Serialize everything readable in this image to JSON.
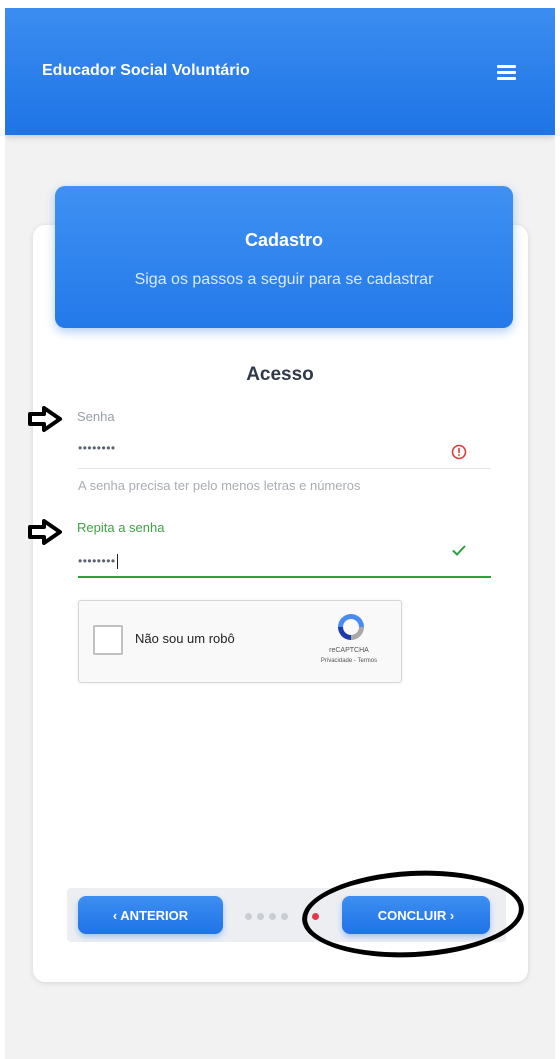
{
  "app": {
    "title": "Educador Social Voluntário",
    "menu_icon": "hamburger-menu-icon"
  },
  "card": {
    "title": "Cadastro",
    "subtitle": "Siga os passos a seguir para se cadastrar"
  },
  "section": {
    "title": "Acesso"
  },
  "password": {
    "label": "Senha",
    "value": "••••••••",
    "helper": "A senha precisa ter pelo menos letras e números",
    "status_icon": "error-icon",
    "status_color": "#e53935"
  },
  "confirm_password": {
    "label": "Repita a senha",
    "value": "••••••••",
    "status_icon": "check-icon",
    "status_color": "#2e9e3e"
  },
  "recaptcha": {
    "checkbox_label": "Não sou um robô",
    "brand": "reCAPTCHA",
    "links": "Privacidade - Termos"
  },
  "nav": {
    "prev_label": "‹ ANTERIOR",
    "next_label": "CONCLUIR ›",
    "steps_total": 5,
    "current_step": 5
  },
  "colors": {
    "primary": "#2479ea",
    "success": "#2e9e3e",
    "error": "#e53935",
    "step_active": "#e33a4c"
  }
}
